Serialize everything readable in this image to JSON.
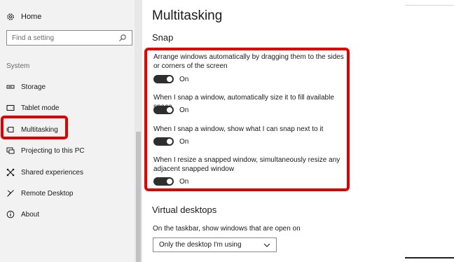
{
  "sidebar": {
    "home_label": "Home",
    "search_placeholder": "Find a setting",
    "group_label": "System",
    "items": [
      {
        "label": "Storage",
        "icon": "storage-icon"
      },
      {
        "label": "Tablet mode",
        "icon": "tablet-mode-icon"
      },
      {
        "label": "Multitasking",
        "icon": "multitasking-icon",
        "selected": true
      },
      {
        "label": "Projecting to this PC",
        "icon": "projecting-icon"
      },
      {
        "label": "Shared experiences",
        "icon": "shared-experiences-icon"
      },
      {
        "label": "Remote Desktop",
        "icon": "remote-desktop-icon"
      },
      {
        "label": "About",
        "icon": "about-icon"
      }
    ]
  },
  "main": {
    "title": "Multitasking",
    "snap": {
      "heading": "Snap",
      "options": [
        {
          "label": "Arrange windows automatically by dragging them to the sides or corners of the screen",
          "state": "On"
        },
        {
          "label": "When I snap a window, automatically size it to fill available space",
          "state": "On"
        },
        {
          "label": "When I snap a window, show what I can snap next to it",
          "state": "On"
        },
        {
          "label": "When I resize a snapped window, simultaneously resize any adjacent snapped window",
          "state": "On"
        }
      ]
    },
    "virtual_desktops": {
      "heading": "Virtual desktops",
      "taskbar_label": "On the taskbar, show windows that are open on",
      "taskbar_value": "Only the desktop I'm using"
    }
  },
  "colors": {
    "highlight": "#e00000",
    "toggle_on": "#2e2e2e",
    "sidebar_bg": "#f2f2f2"
  }
}
